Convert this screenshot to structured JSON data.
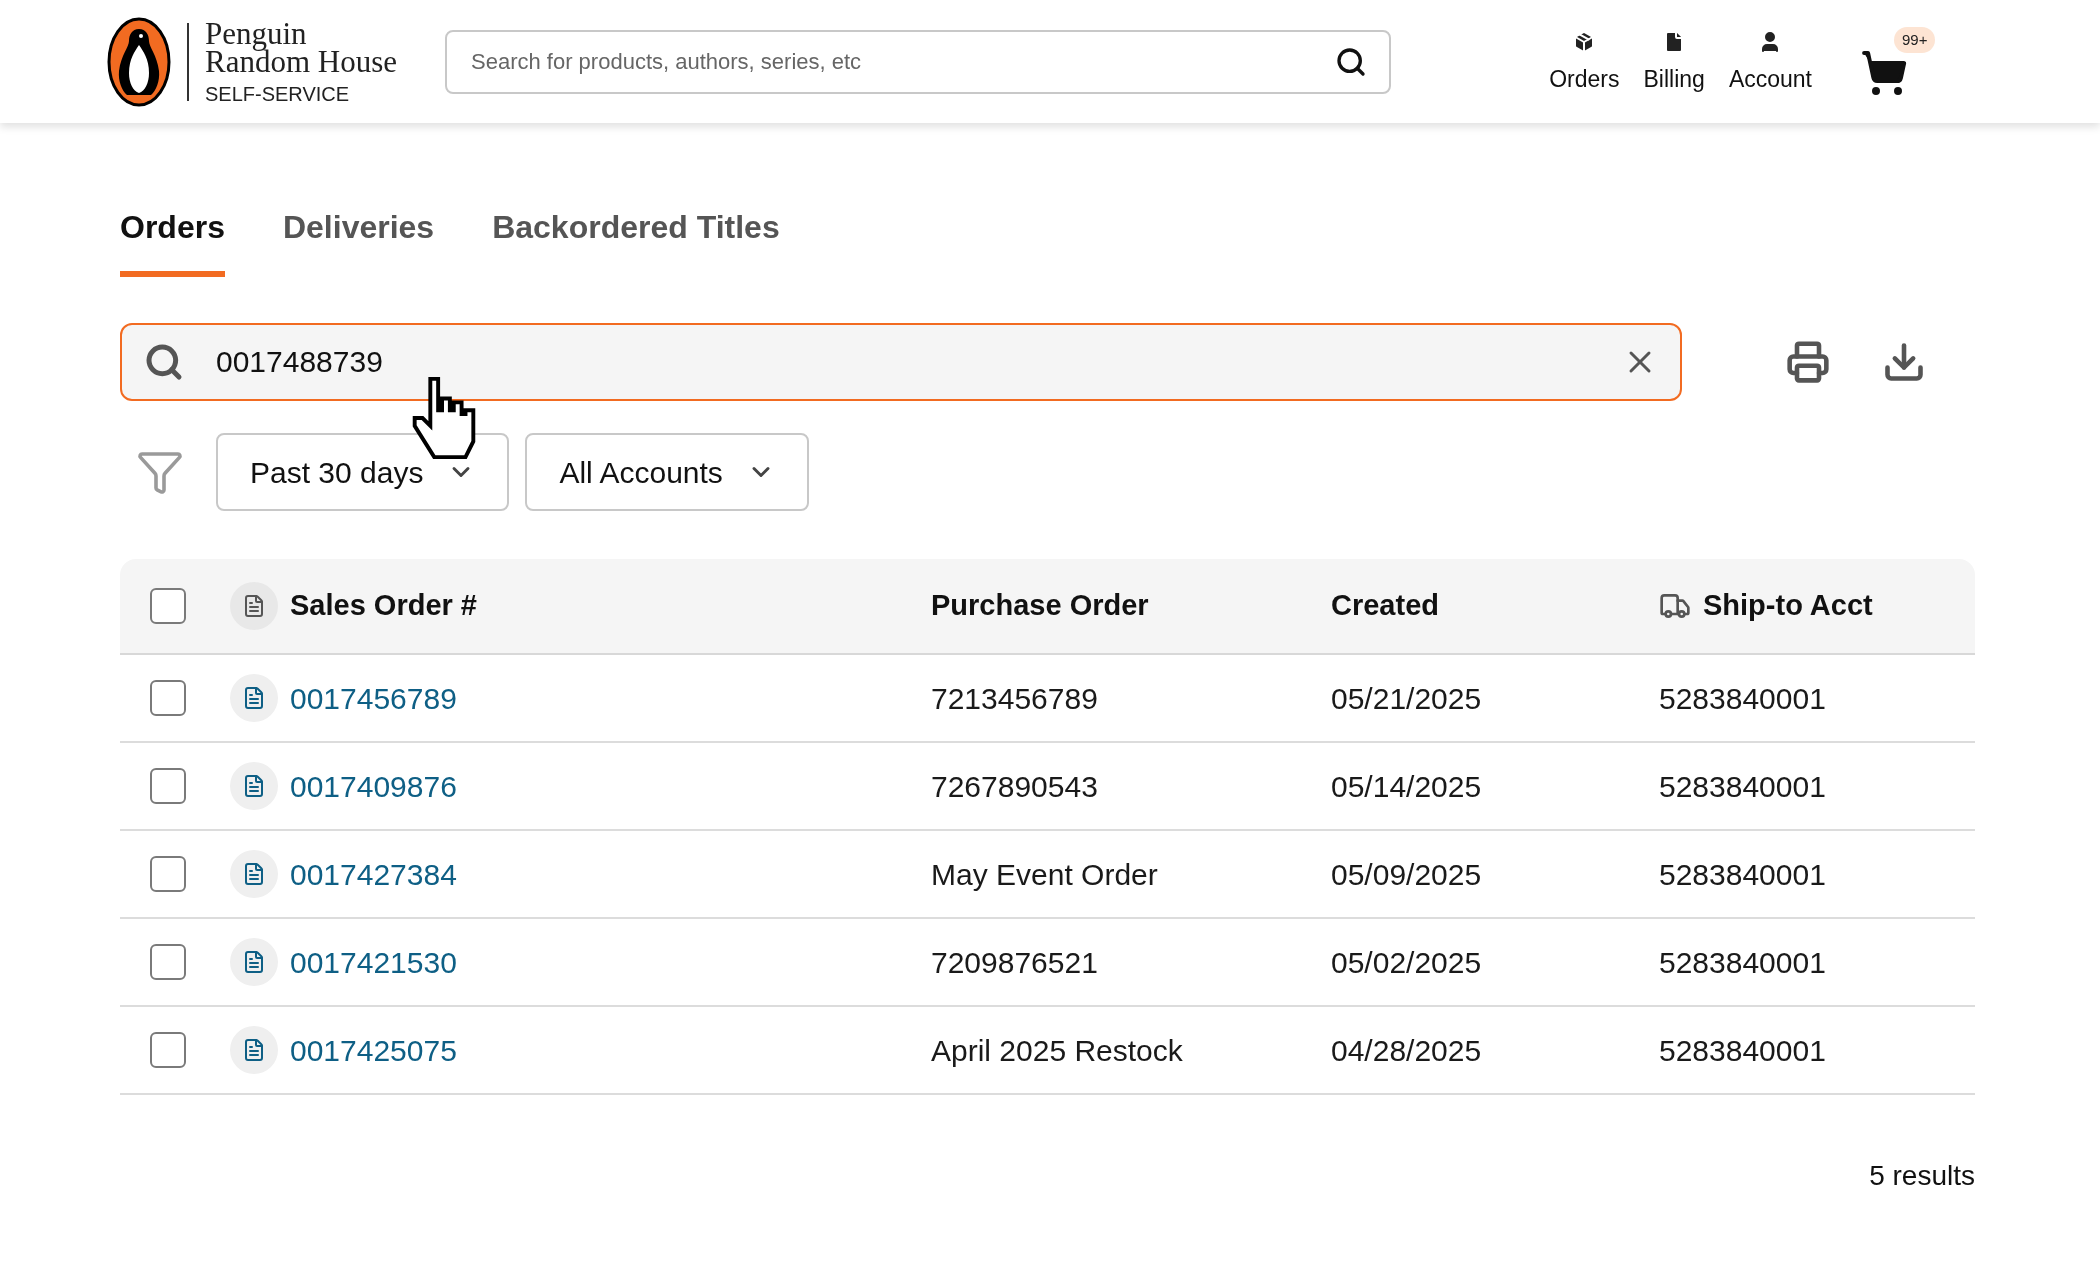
{
  "header": {
    "logo": {
      "line1": "Penguin",
      "line2": "Random House",
      "subtitle": "SELF-SERVICE"
    },
    "search": {
      "placeholder": "Search for products, authors, series, etc"
    },
    "nav": [
      {
        "kind": "orders",
        "label": "Orders"
      },
      {
        "kind": "billing",
        "label": "Billing"
      },
      {
        "kind": "account",
        "label": "Account"
      }
    ],
    "cart": {
      "badge": "99+"
    }
  },
  "tabs": [
    {
      "label": "Orders",
      "selected": true
    },
    {
      "label": "Deliveries",
      "selected": false
    },
    {
      "label": "Backordered Titles",
      "selected": false
    }
  ],
  "order_search": {
    "value": "0017488739"
  },
  "filters": [
    {
      "label": "Past 30 days"
    },
    {
      "label": "All Accounts"
    }
  ],
  "table": {
    "columns": [
      "Sales Order #",
      "Purchase Order",
      "Created",
      "Ship-to Acct"
    ],
    "all_checked": false,
    "rows": [
      {
        "checked": false,
        "sales_order": "0017456789",
        "purchase_order": "7213456789",
        "created": "05/21/2025",
        "ship_to": "5283840001"
      },
      {
        "checked": false,
        "sales_order": "0017409876",
        "purchase_order": "7267890543",
        "created": "05/14/2025",
        "ship_to": "5283840001"
      },
      {
        "checked": false,
        "sales_order": "0017427384",
        "purchase_order": "May Event Order",
        "created": "05/09/2025",
        "ship_to": "5283840001"
      },
      {
        "checked": false,
        "sales_order": "0017421530",
        "purchase_order": "7209876521",
        "created": "05/02/2025",
        "ship_to": "5283840001"
      },
      {
        "checked": false,
        "sales_order": "0017425075",
        "purchase_order": "April 2025 Restock",
        "created": "04/28/2025",
        "ship_to": "5283840001"
      }
    ]
  },
  "results": "5 results"
}
